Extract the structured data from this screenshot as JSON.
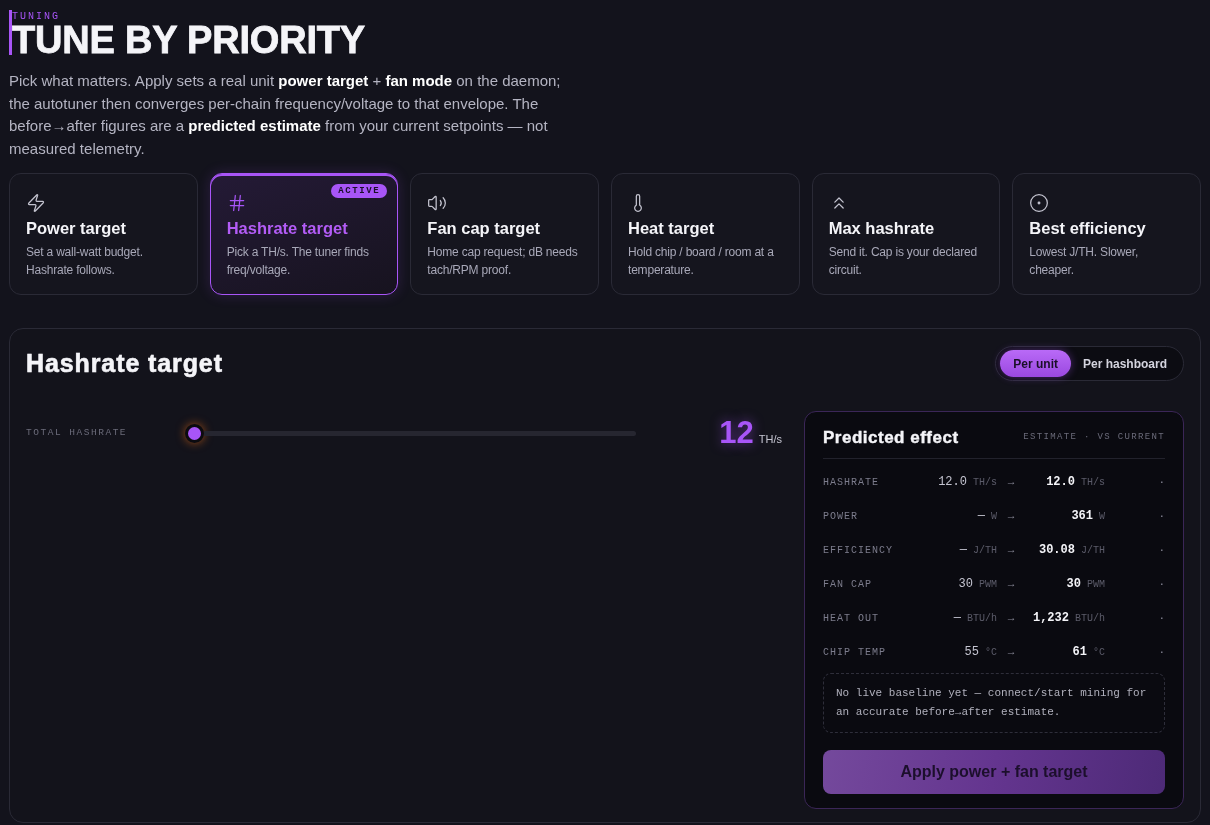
{
  "header": {
    "eyebrow": "TUNING",
    "title": "TUNE BY PRIORITY",
    "intro": "Pick what matters. Apply sets a real unit **power target** + **fan mode** on the daemon; the autotuner then converges per-chain frequency/voltage to that envelope. The before→after figures are a **predicted estimate** from your current setpoints — not measured telemetry."
  },
  "modes": [
    {
      "title": "Power target",
      "description": "Set a wall-watt budget. Hashrate follows.",
      "selected": false
    },
    {
      "title": "Hashrate target",
      "description": "Pick a TH/s. The tuner finds freq/voltage.",
      "selected": true,
      "badge": "ACTIVE"
    },
    {
      "title": "Fan cap target",
      "description": "Home cap request; dB needs tach/RPM proof.",
      "selected": false
    },
    {
      "title": "Heat target",
      "description": "Hold chip / board / room at a temperature.",
      "selected": false
    },
    {
      "title": "Max hashrate",
      "description": "Send it. Cap is your declared circuit.",
      "selected": false
    },
    {
      "title": "Best efficiency",
      "description": "Lowest J/TH. Slower, cheaper.",
      "selected": false
    }
  ],
  "panel": {
    "title": "Hashrate target",
    "scope_toggle": [
      {
        "label": "Per unit",
        "selected": true
      },
      {
        "label": "Per hashboard",
        "selected": false
      }
    ],
    "slider": {
      "label": "TOTAL HASHRATE",
      "level": 0,
      "value": "12",
      "unit": "TH/s"
    },
    "predicted": {
      "title": "Predicted effect",
      "subtitle": "ESTIMATE · VS CURRENT",
      "rows": [
        {
          "label": "HASHRATE",
          "before": "12.0",
          "before_unit": "TH/s",
          "arrow": "→",
          "after": "12.0",
          "after_unit": "TH/s",
          "change": "·"
        },
        {
          "label": "POWER",
          "before": "—",
          "before_unit": "W",
          "arrow": "→",
          "after": "361",
          "after_unit": "W",
          "change": "·"
        },
        {
          "label": "EFFICIENCY",
          "before": "—",
          "before_unit": "J/TH",
          "arrow": "→",
          "after": "30.08",
          "after_unit": "J/TH",
          "change": "·"
        },
        {
          "label": "FAN CAP",
          "before": "30",
          "before_unit": "PWM",
          "arrow": "→",
          "after": "30",
          "after_unit": "PWM",
          "change": "·"
        },
        {
          "label": "HEAT OUT",
          "before": "—",
          "before_unit": "BTU/h",
          "arrow": "→",
          "after": "1,232",
          "after_unit": "BTU/h",
          "change": "·"
        },
        {
          "label": "CHIP TEMP",
          "before": "55",
          "before_unit": "°C",
          "arrow": "→",
          "after": "61",
          "after_unit": "°C",
          "change": "·"
        }
      ],
      "note": "No live baseline yet — connect/start mining for an accurate before→after estimate.",
      "apply_button": "Apply power + fan target"
    }
  }
}
